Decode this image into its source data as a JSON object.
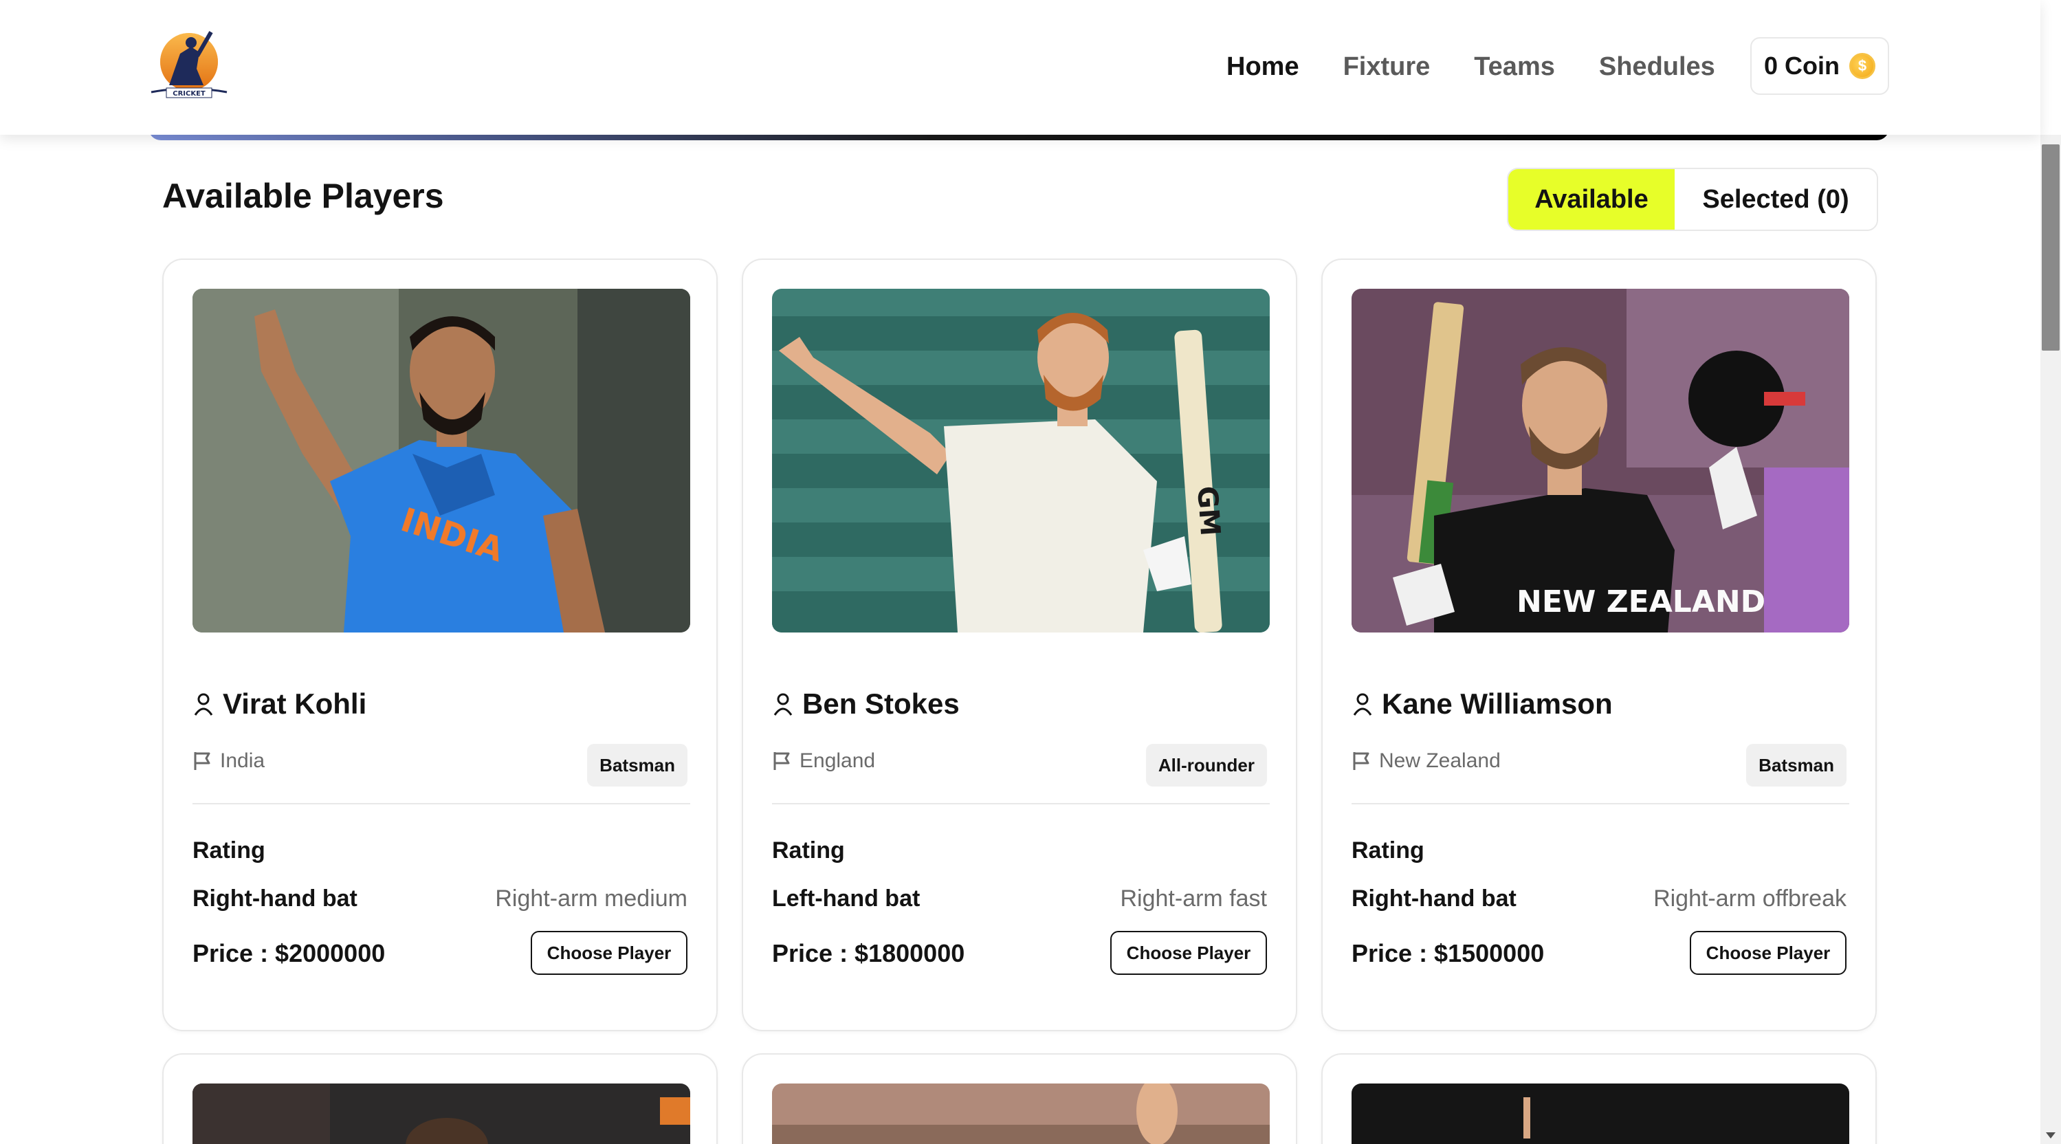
{
  "nav": {
    "logo_text": "CRICKET",
    "links": [
      "Home",
      "Fixture",
      "Teams",
      "Shedules"
    ],
    "coin_label": "0 Coin",
    "coin_symbol": "$"
  },
  "section": {
    "title": "Available Players",
    "available_label": "Available",
    "selected_label": "Selected (0)"
  },
  "players": [
    {
      "name": "Virat Kohli",
      "country": "India",
      "role": "Batsman",
      "rating_label": "Rating",
      "batting": "Right-hand bat",
      "bowling": "Right-arm medium",
      "price": "Price : $2000000",
      "button": "Choose Player",
      "photo_colors": {
        "bg": "#6f7a6a",
        "shirt": "#2a7fe0",
        "skin": "#b07a55"
      }
    },
    {
      "name": "Ben Stokes",
      "country": "England",
      "role": "All-rounder",
      "rating_label": "Rating",
      "batting": "Left-hand bat",
      "bowling": "Right-arm fast",
      "price": "Price : $1800000",
      "button": "Choose Player",
      "photo_colors": {
        "bg": "#3f7f76",
        "shirt": "#f1efe6",
        "skin": "#e2b08c"
      }
    },
    {
      "name": "Kane Williamson",
      "country": "New Zealand",
      "role": "Batsman",
      "rating_label": "Rating",
      "batting": "Right-hand bat",
      "bowling": "Right-arm offbreak",
      "price": "Price : $1500000",
      "button": "Choose Player",
      "photo_colors": {
        "bg": "#8a5f7d",
        "shirt": "#141414",
        "skin": "#d9a884"
      }
    }
  ],
  "colors": {
    "accent": "#e7fe29",
    "text": "#131313",
    "muted": "#6a6a6a",
    "border": "#e8e8e8"
  }
}
